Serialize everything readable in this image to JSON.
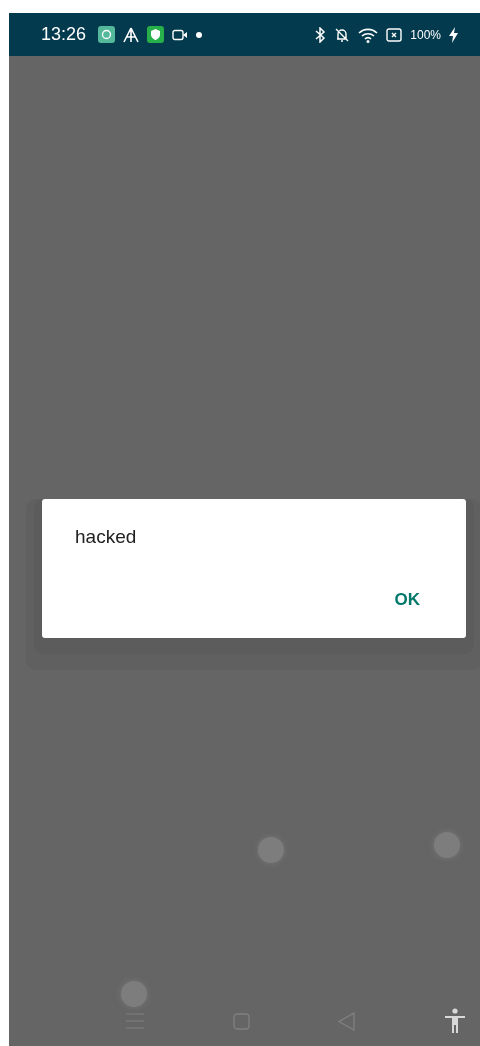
{
  "status_bar": {
    "time": "13:26",
    "battery": "100%"
  },
  "dialog": {
    "message": "hacked",
    "buttons": [
      "OK"
    ]
  }
}
